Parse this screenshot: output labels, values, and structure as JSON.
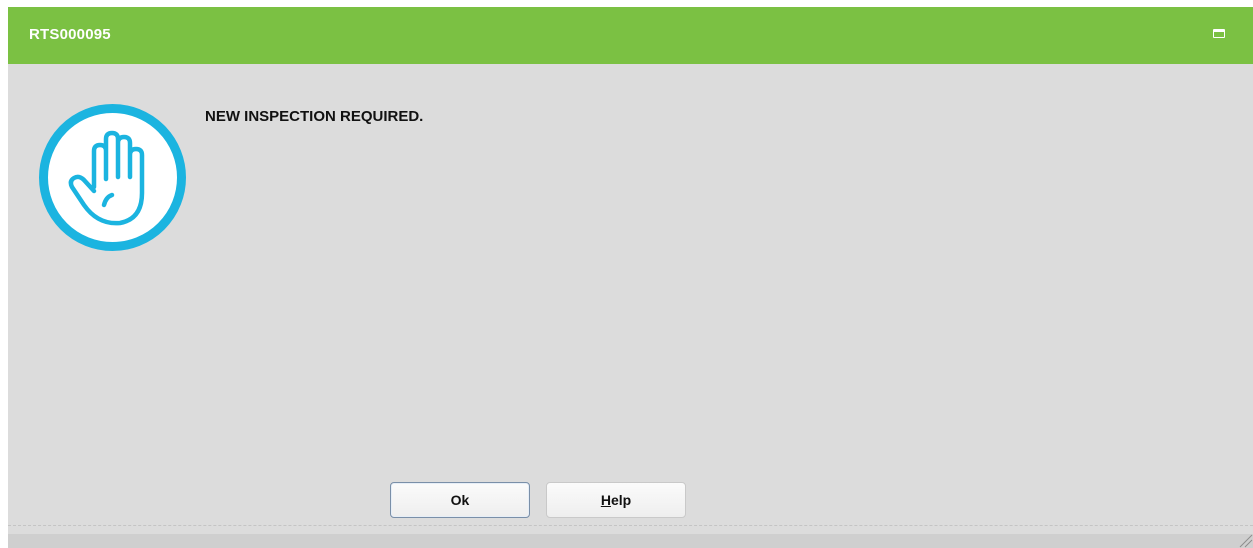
{
  "window": {
    "title": "RTS000095",
    "titlebar_color": "#7bc143",
    "maximize_icon": "maximize-icon"
  },
  "dialog": {
    "icon": "stop-hand-icon",
    "icon_color": "#1bb4e0",
    "message": "NEW INSPECTION REQUIRED."
  },
  "buttons": {
    "ok_label": "Ok",
    "help_label_mnemonic": "H",
    "help_label_rest": "elp"
  }
}
